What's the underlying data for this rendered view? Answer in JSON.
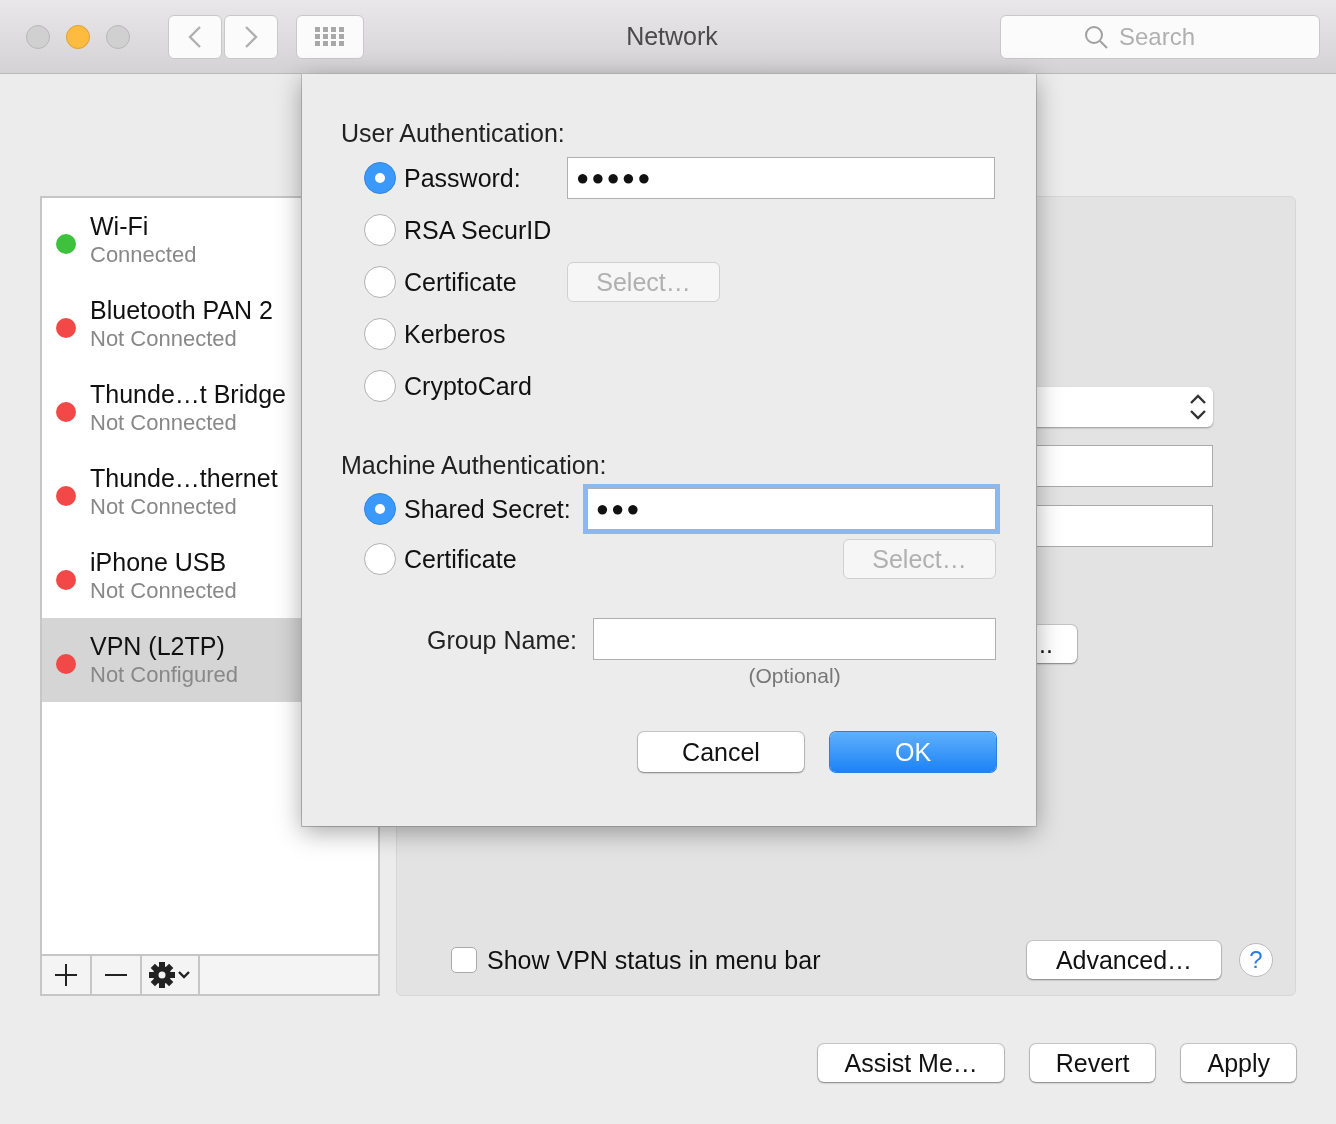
{
  "window": {
    "title": "Network"
  },
  "search": {
    "placeholder": "Search"
  },
  "services": [
    {
      "name": "Wi-Fi",
      "status": "Connected",
      "color": "#3ec23e",
      "selected": false
    },
    {
      "name": "Bluetooth PAN 2",
      "status": "Not Connected",
      "color": "#f34848",
      "selected": false
    },
    {
      "name": "Thunde…t Bridge",
      "status": "Not Connected",
      "color": "#f34848",
      "selected": false
    },
    {
      "name": "Thunde…thernet",
      "status": "Not Connected",
      "color": "#f34848",
      "selected": false
    },
    {
      "name": "iPhone USB",
      "status": "Not Connected",
      "color": "#f34848",
      "selected": false
    },
    {
      "name": "VPN (L2TP)",
      "status": "Not Configured",
      "color": "#f34848",
      "selected": true
    }
  ],
  "panel": {
    "partial_button": "..",
    "show_vpn_status": {
      "label": "Show VPN status in menu bar",
      "checked": false
    },
    "advanced_button": "Advanced…",
    "help": "?"
  },
  "sheet": {
    "user_auth": {
      "heading": "User Authentication:",
      "options": [
        {
          "label": "Password:",
          "selected": true,
          "kind": "field",
          "value": "●●●●●"
        },
        {
          "label": "RSA SecurID",
          "selected": false,
          "kind": "plain"
        },
        {
          "label": "Certificate",
          "selected": false,
          "kind": "button",
          "button": "Select…",
          "disabled": true
        },
        {
          "label": "Kerberos",
          "selected": false,
          "kind": "plain"
        },
        {
          "label": "CryptoCard",
          "selected": false,
          "kind": "plain"
        }
      ]
    },
    "machine_auth": {
      "heading": "Machine Authentication:",
      "options": [
        {
          "label": "Shared Secret:",
          "selected": true,
          "kind": "field",
          "value": "●●●",
          "focused": true
        },
        {
          "label": "Certificate",
          "selected": false,
          "kind": "button",
          "button": "Select…",
          "disabled": true
        }
      ]
    },
    "group_name": {
      "label": "Group Name:",
      "hint": "(Optional)"
    },
    "buttons": [
      {
        "label": "Cancel",
        "default": false
      },
      {
        "label": "OK",
        "default": true
      }
    ]
  },
  "bottom_buttons": [
    "Assist Me…",
    "Revert",
    "Apply"
  ]
}
